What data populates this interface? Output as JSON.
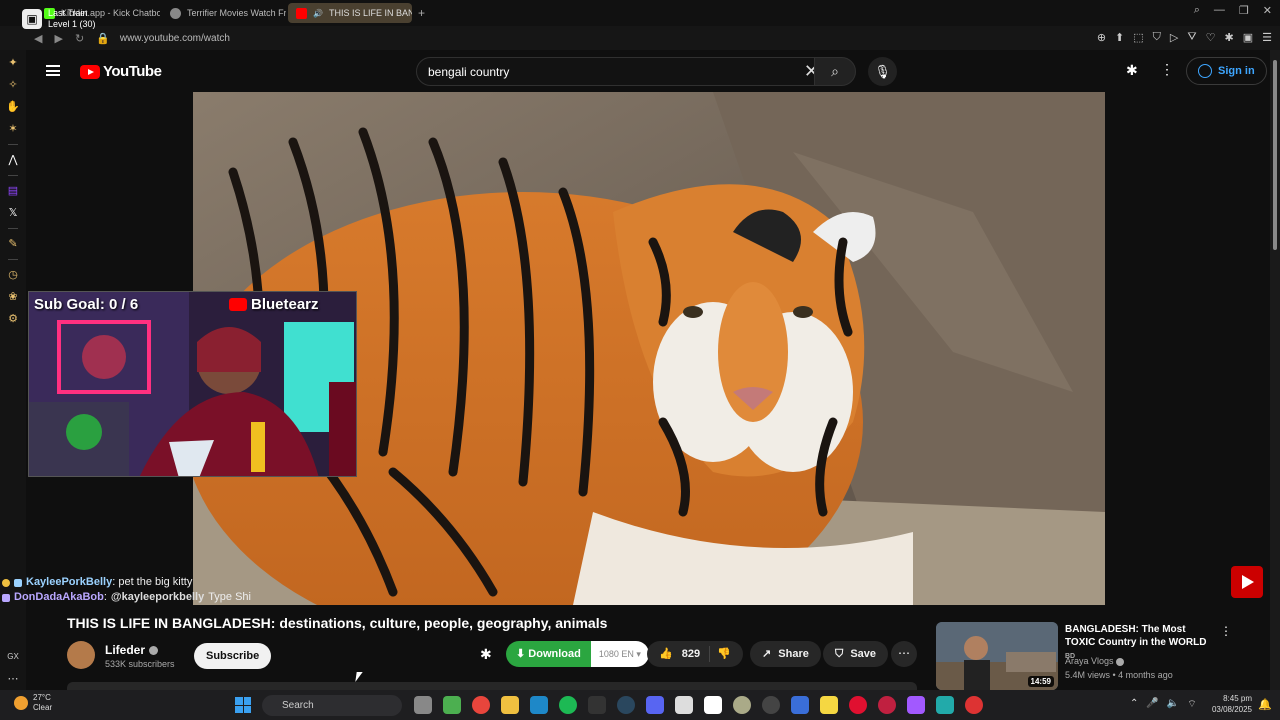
{
  "browser": {
    "tabs": [
      {
        "label": "Kicklet.app - Kick Chatbo",
        "color": "#53fc18",
        "active": false
      },
      {
        "label": "Terrifier Movies Watch Fr",
        "color": "#aaaaaa",
        "active": false
      },
      {
        "label": "THIS IS LIFE IN BANG",
        "color": "#ff0000",
        "active": true
      }
    ],
    "new_tab": "+",
    "url": "www.youtube.com/watch"
  },
  "now_playing": {
    "title": "Last Train",
    "level": "Level 1 (30)"
  },
  "youtube": {
    "logo_text": "YouTube",
    "search_query": "bengali country",
    "sign_in": "Sign in"
  },
  "overlay": {
    "sub_goal": "Sub Goal: 0 / 6",
    "channel": "Bluetearz",
    "chat": [
      {
        "user": "KayleePorkBelly",
        "message": ": pet the big kitty",
        "user_color": "#9bd2ff",
        "badge_color": "#f0c040"
      },
      {
        "user": "DonDadaAkaBob",
        "message": ": @kayleeporkbelly Type Shi",
        "mention": "@kayleeporkbelly",
        "rest": "Type Shi",
        "user_color": "#b9a7ff",
        "badge_color": "#a080ff"
      }
    ]
  },
  "video": {
    "title": "THIS IS LIFE IN BANGLADESH: destinations, culture, people, geography, animals",
    "channel": "Lifeder",
    "subscribers": "533K subscribers",
    "subscribe_label": "Subscribe",
    "download_label": "Download",
    "quality": "1080 EN",
    "likes": "829",
    "share_label": "Share",
    "save_label": "Save"
  },
  "recommended": {
    "title": "BANGLADESH: The Most TOXIC Country in the WORLD",
    "title_suffix": "BD",
    "channel": "Araya Vlogs",
    "meta": "5.4M views • 4 months ago",
    "duration": "14:59"
  },
  "taskbar": {
    "temperature": "27°C",
    "condition": "Clear",
    "search_label": "Search",
    "time": "8:45 pm",
    "date": "03/08/2025"
  },
  "sidebar_left": {
    "bottom_label": "GX"
  }
}
